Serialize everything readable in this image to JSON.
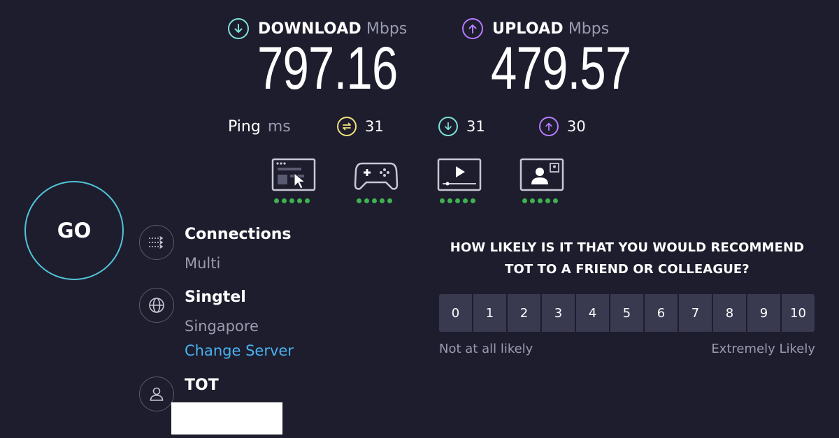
{
  "download": {
    "label": "DOWNLOAD",
    "unit": "Mbps",
    "value": "797.16",
    "color": "#7fe3d8"
  },
  "upload": {
    "label": "UPLOAD",
    "unit": "Mbps",
    "value": "479.57",
    "color": "#b67cff"
  },
  "ping": {
    "label": "Ping",
    "unit": "ms",
    "idle": "31",
    "download": "31",
    "upload": "30",
    "idle_color": "#f4e07b"
  },
  "quality_icons": [
    "browsing-icon",
    "gaming-icon",
    "streaming-icon",
    "video-call-icon"
  ],
  "go_button": {
    "label": "GO",
    "ring_color": "#52c4d7"
  },
  "connections": {
    "title": "Connections",
    "value": "Multi"
  },
  "server": {
    "title": "Singtel",
    "location": "Singapore",
    "change_label": "Change Server",
    "link_color": "#4ab2f0"
  },
  "provider": {
    "title": "TOT"
  },
  "survey": {
    "line1": "HOW LIKELY IS IT THAT YOU WOULD RECOMMEND",
    "line2": "TOT TO A FRIEND OR COLLEAGUE?",
    "options": [
      "0",
      "1",
      "2",
      "3",
      "4",
      "5",
      "6",
      "7",
      "8",
      "9",
      "10"
    ],
    "low_label": "Not at all likely",
    "high_label": "Extremely Likely"
  }
}
